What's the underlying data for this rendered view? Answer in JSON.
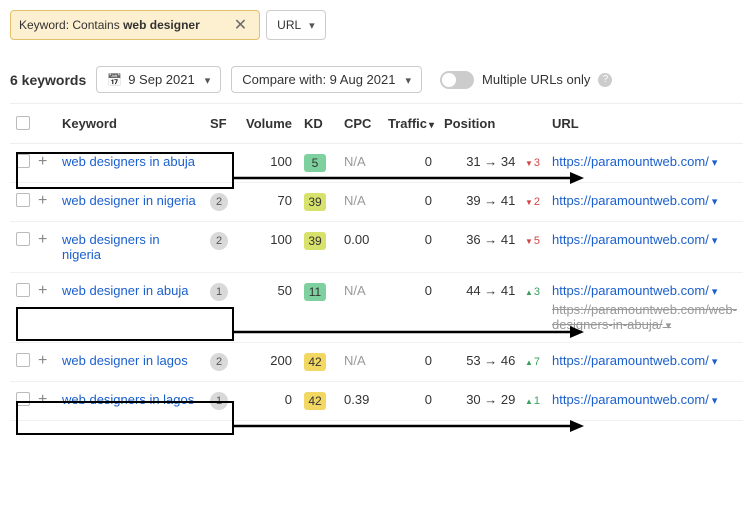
{
  "filters": {
    "keyword_chip_prefix": "Keyword: Contains ",
    "keyword_chip_value": "web designer",
    "url_button": "URL"
  },
  "toolbar": {
    "count": "6 keywords",
    "date": "9 Sep 2021",
    "compare_label": "Compare with: 9 Aug 2021",
    "multi_url_label": "Multiple URLs only"
  },
  "columns": {
    "keyword": "Keyword",
    "sf": "SF",
    "volume": "Volume",
    "kd": "KD",
    "cpc": "CPC",
    "traffic": "Traffic",
    "position": "Position",
    "url": "URL"
  },
  "rows": [
    {
      "keyword": "web designers in abuja",
      "sf": "",
      "volume": "100",
      "kd": "5",
      "kd_class": "kd-green",
      "cpc": "N/A",
      "cpc_muted": true,
      "traffic": "0",
      "pos_from": "31",
      "pos_to": "34",
      "pos_change": "3",
      "pos_dir": "down",
      "url": "https://paramountweb.com/",
      "url_old": ""
    },
    {
      "keyword": "web designer in nigeria",
      "sf": "2",
      "volume": "70",
      "kd": "39",
      "kd_class": "kd-lime",
      "cpc": "N/A",
      "cpc_muted": true,
      "traffic": "0",
      "pos_from": "39",
      "pos_to": "41",
      "pos_change": "2",
      "pos_dir": "down",
      "url": "https://paramountweb.com/",
      "url_old": ""
    },
    {
      "keyword": "web designers in nigeria",
      "sf": "2",
      "volume": "100",
      "kd": "39",
      "kd_class": "kd-lime",
      "cpc": "0.00",
      "cpc_muted": false,
      "traffic": "0",
      "pos_from": "36",
      "pos_to": "41",
      "pos_change": "5",
      "pos_dir": "down",
      "url": "https://paramountweb.com/",
      "url_old": ""
    },
    {
      "keyword": "web designer in abuja",
      "sf": "1",
      "volume": "50",
      "kd": "11",
      "kd_class": "kd-green",
      "cpc": "N/A",
      "cpc_muted": true,
      "traffic": "0",
      "pos_from": "44",
      "pos_to": "41",
      "pos_change": "3",
      "pos_dir": "up",
      "url": "https://paramountweb.com/",
      "url_old": "https://paramountweb.com/web-designers-in-abuja/"
    },
    {
      "keyword": "web designer in lagos",
      "sf": "2",
      "volume": "200",
      "kd": "42",
      "kd_class": "kd-yellow",
      "cpc": "N/A",
      "cpc_muted": true,
      "traffic": "0",
      "pos_from": "53",
      "pos_to": "46",
      "pos_change": "7",
      "pos_dir": "up",
      "url": "https://paramountweb.com/",
      "url_old": ""
    },
    {
      "keyword": "web designers in lagos",
      "sf": "1",
      "volume": "0",
      "kd": "42",
      "kd_class": "kd-yellow",
      "cpc": "0.39",
      "cpc_muted": false,
      "traffic": "0",
      "pos_from": "30",
      "pos_to": "29",
      "pos_change": "1",
      "pos_dir": "up",
      "url": "https://paramountweb.com/",
      "url_old": ""
    }
  ]
}
